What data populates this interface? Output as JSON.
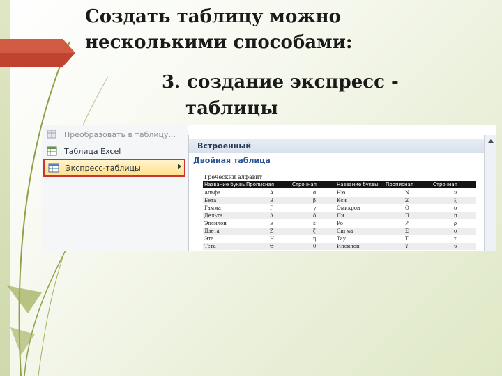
{
  "slide": {
    "title": "Создать таблицу можно несколькими способами:",
    "subtitle_line1": "3. создание экспресс -",
    "subtitle_line2": "таблицы"
  },
  "menu": {
    "items": [
      {
        "label": "Преобразовать в таблицу...",
        "icon": "convert-table-icon",
        "disabled": true
      },
      {
        "label": "Таблица Excel",
        "icon": "excel-table-icon",
        "disabled": false
      },
      {
        "label": "Экспресс-таблицы",
        "icon": "quick-tables-icon",
        "disabled": false,
        "highlighted": true
      }
    ]
  },
  "gallery": {
    "header": "Встроенный",
    "item_title": "Двойная таблица",
    "table_caption": "Греческий алфавит",
    "columns": [
      "Название буквы",
      "Прописная",
      "Строчная",
      "Название буквы",
      "Прописная",
      "Строчная"
    ],
    "rows": [
      [
        "Альфа",
        "Α",
        "α",
        "Ню",
        "Ν",
        "ν"
      ],
      [
        "Бета",
        "Β",
        "β",
        "Кси",
        "Ξ",
        "ξ"
      ],
      [
        "Гамма",
        "Γ",
        "γ",
        "Омикрон",
        "Ο",
        "ο"
      ],
      [
        "Дельта",
        "Δ",
        "δ",
        "Пи",
        "Π",
        "π"
      ],
      [
        "Эпсилон",
        "Ε",
        "ε",
        "Ро",
        "Ρ",
        "ρ"
      ],
      [
        "Дзета",
        "Ζ",
        "ζ",
        "Сигма",
        "Σ",
        "σ"
      ],
      [
        "Эта",
        "Η",
        "η",
        "Тау",
        "Τ",
        "τ"
      ],
      [
        "Тета",
        "Θ",
        "θ",
        "Ипсилон",
        "Υ",
        "υ"
      ]
    ]
  },
  "colors": {
    "accent_red": "#c9362e",
    "highlight": "#ffe08c"
  }
}
